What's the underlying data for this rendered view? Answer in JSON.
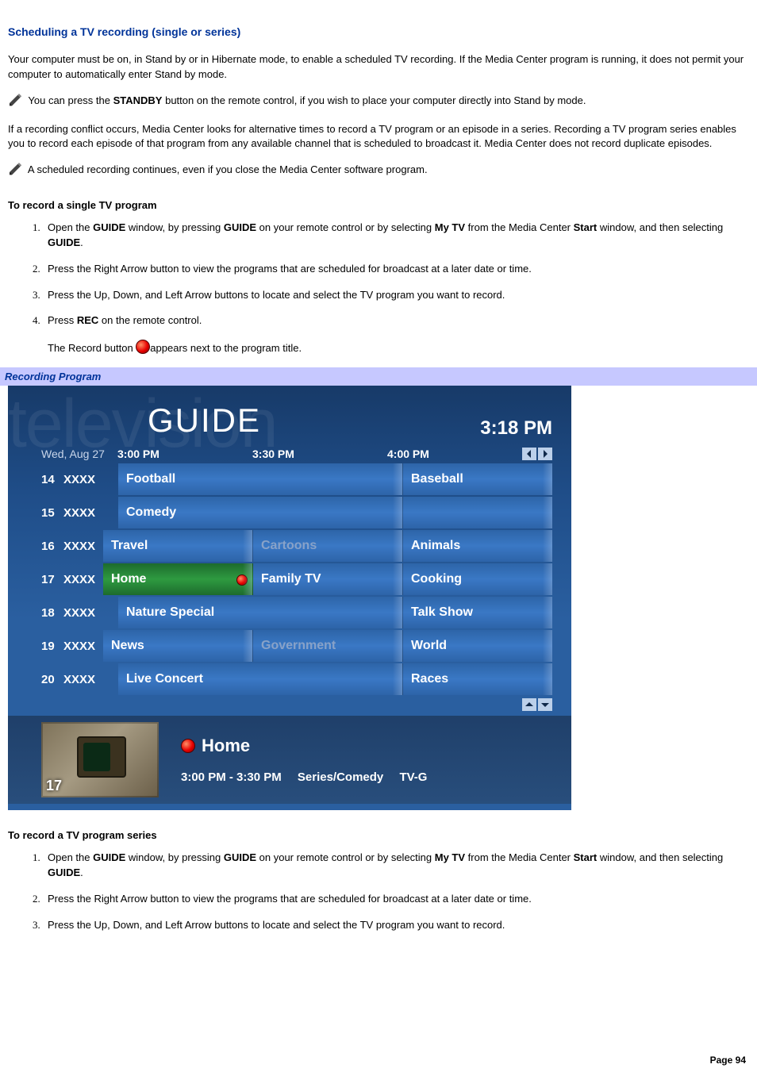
{
  "title": "Scheduling a TV recording (single or series)",
  "intro": "Your computer must be on, in Stand by or in Hibernate mode, to enable a scheduled TV recording. If the Media Center program is running, it does not permit your computer to automatically enter Stand by mode.",
  "note1_pre": "You can press the ",
  "note1_b": "STANDBY",
  "note1_post": " button on the remote control, if you wish to place your computer directly into Stand by mode.",
  "conflict": "If a recording conflict occurs, Media Center looks for alternative times to record a TV program or an episode in a series. Recording a TV program series enables you to record each episode of that program from any available channel that is scheduled to broadcast it. Media Center does not record duplicate episodes.",
  "note2": "A scheduled recording continues, even if you close the Media Center software program.",
  "sub1": "To record a single TV program",
  "steps1": {
    "s1_a": "Open the ",
    "s1_b1": "GUIDE",
    "s1_c": " window, by pressing ",
    "s1_b2": "GUIDE",
    "s1_d": " on your remote control or by selecting ",
    "s1_b3": "My TV",
    "s1_e": " from the Media Center ",
    "s1_b4": "Start",
    "s1_f": " window, and then selecting ",
    "s1_b5": "GUIDE",
    "s1_g": ".",
    "s2": "Press the Right Arrow button to view the programs that are scheduled for broadcast at a later date or time.",
    "s3": "Press the Up, Down, and Left Arrow buttons to locate and select the TV program you want to record.",
    "s4_a": "Press ",
    "s4_b": "REC",
    "s4_c": " on the remote control.",
    "s4_2a": "The Record button ",
    "s4_2b": "appears next to the program title."
  },
  "fig_caption": "Recording Program",
  "guide": {
    "bg_word": "television",
    "title": "GUIDE",
    "clock": "3:18 PM",
    "date": "Wed, Aug 27",
    "cols": [
      "3:00 PM",
      "3:30 PM",
      "4:00 PM"
    ],
    "channels": [
      {
        "num": "14",
        "name": "XXXX",
        "cells": [
          {
            "label": "Football",
            "span": 2
          },
          {
            "label": "Baseball",
            "span": 1
          }
        ]
      },
      {
        "num": "15",
        "name": "XXXX",
        "cells": [
          {
            "label": "Comedy",
            "span": 2
          },
          {
            "label": "",
            "span": 1
          }
        ]
      },
      {
        "num": "16",
        "name": "XXXX",
        "cells": [
          {
            "label": "Travel",
            "span": 1
          },
          {
            "label": "Cartoons",
            "span": 1,
            "dim": true
          },
          {
            "label": "Animals",
            "span": 1
          }
        ]
      },
      {
        "num": "17",
        "name": "XXXX",
        "cells": [
          {
            "label": "Home",
            "span": 1,
            "sel": true,
            "rec": true
          },
          {
            "label": "Family TV",
            "span": 1
          },
          {
            "label": "Cooking",
            "span": 1
          }
        ]
      },
      {
        "num": "18",
        "name": "XXXX",
        "cells": [
          {
            "label": "Nature Special",
            "span": 2
          },
          {
            "label": "Talk Show",
            "span": 1
          }
        ]
      },
      {
        "num": "19",
        "name": "XXXX",
        "cells": [
          {
            "label": "News",
            "span": 1
          },
          {
            "label": "Government",
            "span": 1,
            "dim": true
          },
          {
            "label": "World",
            "span": 1
          }
        ]
      },
      {
        "num": "20",
        "name": "XXXX",
        "cells": [
          {
            "label": "Live Concert",
            "span": 2
          },
          {
            "label": "Races",
            "span": 1
          }
        ]
      }
    ],
    "detail": {
      "thumb_num": "17",
      "title": "Home",
      "time": "3:00 PM - 3:30 PM",
      "genre": "Series/Comedy",
      "rating": "TV-G"
    }
  },
  "sub2": "To record a TV program series",
  "steps2": {
    "s1_a": "Open the ",
    "s1_b1": "GUIDE",
    "s1_c": " window, by pressing ",
    "s1_b2": "GUIDE",
    "s1_d": " on your remote control or by selecting ",
    "s1_b3": "My TV",
    "s1_e": " from the Media Center ",
    "s1_b4": "Start",
    "s1_f": " window, and then selecting ",
    "s1_b5": "GUIDE",
    "s1_g": ".",
    "s2": "Press the Right Arrow button to view the programs that are scheduled for broadcast at a later date or time.",
    "s3": "Press the Up, Down, and Left Arrow buttons to locate and select the TV program you want to record."
  },
  "page_num": "Page 94"
}
